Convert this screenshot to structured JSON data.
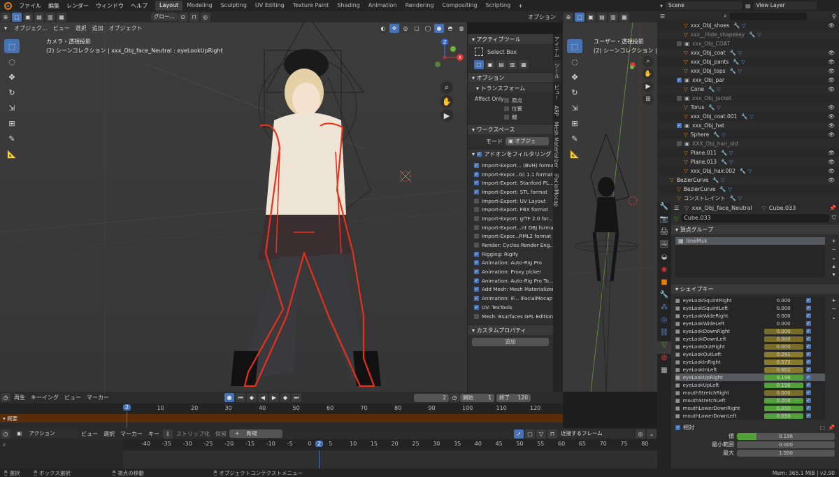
{
  "topbar": {
    "menus": [
      "ファイル",
      "編集",
      "レンダー",
      "ウィンドウ",
      "ヘルプ"
    ],
    "workspaces": [
      "Layout",
      "Modeling",
      "Sculpting",
      "UV Editing",
      "Texture Paint",
      "Shading",
      "Animation",
      "Rendering",
      "Compositing",
      "Scripting"
    ],
    "active_workspace": "Layout",
    "transform_orient": "グロー...",
    "options_label": "オプション",
    "scene": "Scene",
    "view_layer": "View Layer"
  },
  "viewport_main": {
    "header_items": [
      "オブジェク...",
      "ビュー",
      "選択",
      "追加",
      "オブジェクト"
    ],
    "camera_title": "カメラ・透視投影",
    "object_info": "(2) シーンコレクション | xxx_Obj_face_Neutral : eyeLookUpRight",
    "gizmo_axes": [
      "X",
      "Y",
      "Z"
    ]
  },
  "npanel": {
    "active_tool_header": "アクティブツール",
    "active_tool_name": "Select Box",
    "options_header": "オプション",
    "transform_header": "トランスフォーム",
    "affect_only_label": "Affect Only",
    "affect_only_options": [
      "原点",
      "位置",
      "親"
    ],
    "workspace_header": "ワークスペース",
    "mode_label": "モード",
    "mode_value": "オブジェク...",
    "filter_addons": "アドオンをフィルタリング",
    "addons": [
      {
        "label": "Import-Export... (BVH) format",
        "on": true
      },
      {
        "label": "Import-Expor...G) 1.1 format",
        "on": true
      },
      {
        "label": "Import-Export: Stanford PL...",
        "on": true
      },
      {
        "label": "Import-Export: STL format",
        "on": true
      },
      {
        "label": "Import-Export: UV Layout",
        "on": false
      },
      {
        "label": "Import-Export: FBX format",
        "on": false
      },
      {
        "label": "Import-Export: glTF 2.0 for...",
        "on": false
      },
      {
        "label": "Import-Export...nt OBJ format",
        "on": false
      },
      {
        "label": "Import-Expor...RML2 format",
        "on": false
      },
      {
        "label": "Render: Cycles Render Eng...",
        "on": false
      },
      {
        "label": "Rigging: Rigify",
        "on": true
      },
      {
        "label": "Animation: Auto-Rig Pro",
        "on": true
      },
      {
        "label": "Animation: Proxy picker",
        "on": true
      },
      {
        "label": "Animation: Auto-Rig Pro To...",
        "on": true
      },
      {
        "label": "Add Mesh: Mesh Materializer",
        "on": true
      },
      {
        "label": "Animation: iF... iFacialMocap",
        "on": true
      },
      {
        "label": "UV: TexTools",
        "on": true
      },
      {
        "label": "Mesh: Bsurfaces GPL Edition",
        "on": false
      }
    ],
    "custom_props_header": "カスタムプロパティ",
    "add_button": "追加",
    "vertical_tabs": [
      "アイテム",
      "ツール",
      "ビュー",
      "ARP",
      "Mesh Materializer",
      "iFacialMocap"
    ]
  },
  "viewport_side": {
    "title": "ユーザー・透視投影",
    "object_info": "(2) シーンコレクション | xxx"
  },
  "outliner": {
    "search_placeholder": "",
    "rows": [
      {
        "name": "xxx_Obj_shoes",
        "indent": 2,
        "dim": false,
        "vis": true
      },
      {
        "name": "xxx__Hide_shapekey",
        "indent": 2,
        "dim": true,
        "vis": false
      },
      {
        "name": "xxx_Obj_COAT",
        "indent": 1,
        "dim": true,
        "vis": false
      },
      {
        "name": "xxx_Obj_coat",
        "indent": 2,
        "dim": false,
        "vis": true
      },
      {
        "name": "xxx_Obj_pants",
        "indent": 2,
        "dim": false,
        "vis": true
      },
      {
        "name": "xxx_Obj_tops",
        "indent": 2,
        "dim": false,
        "vis": true
      },
      {
        "name": "xxx_Obj_par",
        "indent": 1,
        "dim": false,
        "vis": true
      },
      {
        "name": "Cone",
        "indent": 2,
        "dim": false,
        "vis": true
      },
      {
        "name": "xxx_Obj_jacket",
        "indent": 1,
        "dim": true,
        "vis": false
      },
      {
        "name": "Torus",
        "indent": 2,
        "dim": false,
        "vis": true
      },
      {
        "name": "xxx_Obj_coat.001",
        "indent": 2,
        "dim": false,
        "vis": true
      },
      {
        "name": "xxx_Obj_hat",
        "indent": 1,
        "dim": false,
        "vis": true
      },
      {
        "name": "Sphere",
        "indent": 2,
        "dim": false,
        "vis": true
      },
      {
        "name": "XXX_Obj_hair_old",
        "indent": 1,
        "dim": true,
        "vis": false
      },
      {
        "name": "Plane.011",
        "indent": 2,
        "dim": false,
        "vis": true
      },
      {
        "name": "Plane.013",
        "indent": 2,
        "dim": false,
        "vis": true
      },
      {
        "name": "xxx_Obj_hair.002",
        "indent": 2,
        "dim": false,
        "vis": true
      },
      {
        "name": "BezierCurve",
        "indent": 0,
        "dim": false,
        "vis": true
      },
      {
        "name": "BezierCurve",
        "indent": 1,
        "dim": false,
        "vis": false
      },
      {
        "name": "コンストレイント",
        "indent": 1,
        "dim": false,
        "vis": false
      }
    ]
  },
  "properties": {
    "object_name": "xxx_Obj_face_Neutral",
    "mesh_name": "Cube.033",
    "mesh_field": "Cube.033",
    "vertex_groups_header": "頂点グループ",
    "vertex_group_item": "lineMsk",
    "shape_keys_header": "シェイプキー",
    "shape_keys": [
      {
        "name": "eyeLookSquintRight",
        "value": "0.000",
        "active": false
      },
      {
        "name": "eyeLookSquintLeft",
        "value": "0.000",
        "active": false
      },
      {
        "name": "eyeLookWideRight",
        "value": "0.000",
        "active": false
      },
      {
        "name": "eyeLookWideLeft",
        "value": "0.000",
        "active": false
      },
      {
        "name": "eyeLookDownRight",
        "value": "0.000",
        "active": false
      },
      {
        "name": "eyeLookDownLeft",
        "value": "0.000",
        "active": false
      },
      {
        "name": "eyeLookOutRight",
        "value": "0.000",
        "active": false
      },
      {
        "name": "eyeLookOutLeft",
        "value": "0.291",
        "active": false
      },
      {
        "name": "eyeLookInRight",
        "value": "0.573",
        "active": false
      },
      {
        "name": "eyeLookInLeft",
        "value": "0.602",
        "active": false
      },
      {
        "name": "eyeLookUpRight",
        "value": "0.198",
        "active": true
      },
      {
        "name": "eyeLookUpLeft",
        "value": "0.198",
        "active": false
      },
      {
        "name": "mouthStretchRight",
        "value": "0.000",
        "active": false
      },
      {
        "name": "mouthStretchLeft",
        "value": "0.200",
        "active": false
      },
      {
        "name": "mouthLowerDownRight",
        "value": "0.050",
        "active": false
      },
      {
        "name": "mouthLowerDownLeft",
        "value": "0.050",
        "active": false
      }
    ],
    "relative_label": "相対",
    "value_label": "値",
    "value": "0.198",
    "value_fraction": 0.198,
    "min_label": "最小範囲",
    "min_value": "0.000",
    "max_label": "最大",
    "max_value": "1.000"
  },
  "timeline": {
    "menus": [
      "再生",
      "キーイング",
      "ビュー",
      "マーカー"
    ],
    "current_frame": "2",
    "start_label": "開始",
    "start_value": "1",
    "end_label": "終了",
    "end_value": "120",
    "ticks": [
      "0",
      "10",
      "20",
      "30",
      "40",
      "50",
      "60",
      "70",
      "80",
      "90",
      "100",
      "110",
      "120"
    ],
    "summary_label": "概要"
  },
  "action_editor": {
    "mode": "アクション",
    "menus": [
      "ビュー",
      "選択",
      "マーカー",
      "キー"
    ],
    "strip_label": "ストリップ化",
    "save_label": "保留",
    "new_label": "新規",
    "snap_label": "近接するフレーム",
    "ticks": [
      "-40",
      "-35",
      "-30",
      "-25",
      "-20",
      "-15",
      "-10",
      "-5",
      "0",
      "5",
      "10",
      "15",
      "20",
      "25",
      "30",
      "35",
      "40",
      "45",
      "50",
      "55",
      "60",
      "65",
      "70",
      "75",
      "80"
    ]
  },
  "statusbar": {
    "select": "選択",
    "box_select": "ボックス選択",
    "move_view": "視点の移動",
    "context_menu": "オブジェクトコンテクストメニュー",
    "mem": "Mem: 365.1 MiB | v2.90"
  },
  "colors": {
    "accent": "#4772b3",
    "outline_red": "#e8301a",
    "shape_value_bar": "#8a7a2c",
    "value_green": "#53a03a"
  }
}
